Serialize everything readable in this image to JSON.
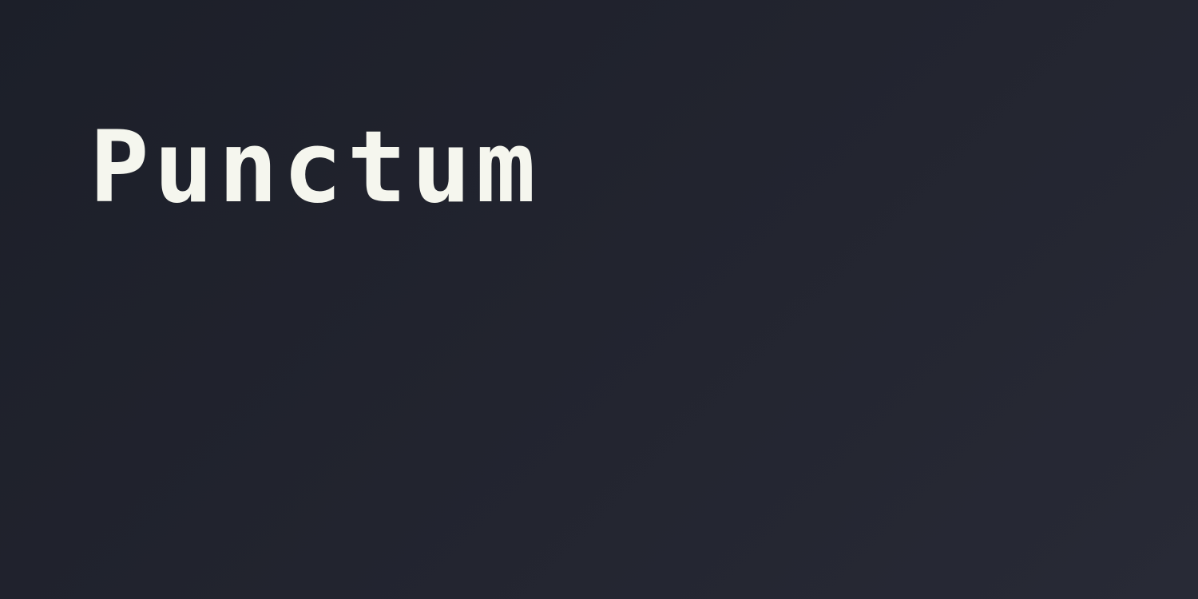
{
  "title": "Punctum",
  "colors": {
    "background": "#22242f",
    "title_text": "#f5f6ee"
  }
}
